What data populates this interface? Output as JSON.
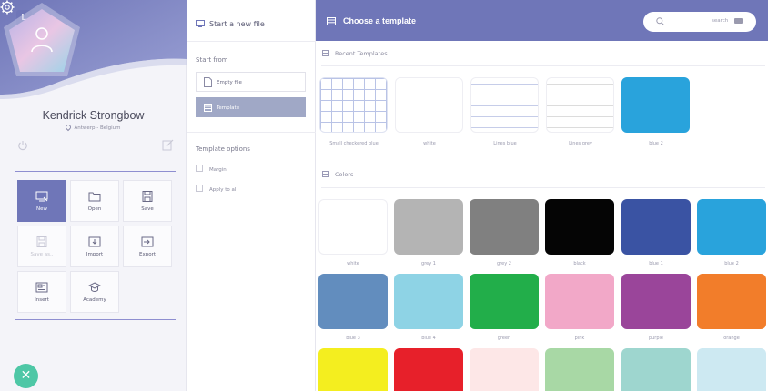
{
  "left": {
    "logo_letter": "L",
    "user": {
      "name": "Kendrick Strongbow",
      "location": "Antwerp - Belgium"
    },
    "actions": [
      {
        "label": "New",
        "icon": "new-file-icon",
        "state": "active"
      },
      {
        "label": "Open",
        "icon": "folder-icon",
        "state": "normal"
      },
      {
        "label": "Save",
        "icon": "floppy-icon",
        "state": "normal"
      },
      {
        "label": "Save as..",
        "icon": "floppy-as-icon",
        "state": "disabled"
      },
      {
        "label": "Import",
        "icon": "import-icon",
        "state": "normal"
      },
      {
        "label": "Export",
        "icon": "export-icon",
        "state": "normal"
      },
      {
        "label": "Insert",
        "icon": "insert-icon",
        "state": "normal"
      },
      {
        "label": "Academy",
        "icon": "graduation-cap-icon",
        "state": "normal"
      }
    ],
    "fab_symbol": "✕"
  },
  "middle": {
    "heading": "Start a new file",
    "start_from_label": "Start from",
    "options": [
      {
        "label": "Empty file",
        "selected": false
      },
      {
        "label": "Template",
        "selected": true
      }
    ],
    "template_options_label": "Template options",
    "checkboxes": [
      {
        "label": "Margin",
        "checked": false
      },
      {
        "label": "Apply to all",
        "checked": false
      }
    ]
  },
  "right": {
    "title": "Choose a template",
    "search_placeholder": "search",
    "recent_label": "Recent Templates",
    "recent": [
      {
        "label": "Small checkered blue",
        "style": "grid"
      },
      {
        "label": "white",
        "style": "blank"
      },
      {
        "label": "Lines blue",
        "style": "lines-blue"
      },
      {
        "label": "Lines grey",
        "style": "lines-grey"
      },
      {
        "label": "blue 2",
        "style": "fill",
        "color": "#29a3dc"
      }
    ],
    "colors_label": "Colors",
    "colors": [
      {
        "label": "white",
        "color": "#ffffff"
      },
      {
        "label": "grey 1",
        "color": "#b4b4b4"
      },
      {
        "label": "grey 2",
        "color": "#808080"
      },
      {
        "label": "black",
        "color": "#050505"
      },
      {
        "label": "blue 1",
        "color": "#3a53a3"
      },
      {
        "label": "blue 2",
        "color": "#29a3dc"
      },
      {
        "label": "blue 3",
        "color": "#628dbe"
      },
      {
        "label": "blue 4",
        "color": "#8ed3e5"
      },
      {
        "label": "green",
        "color": "#22ae4a"
      },
      {
        "label": "pink",
        "color": "#f2a8c8"
      },
      {
        "label": "purple",
        "color": "#9a459a"
      },
      {
        "label": "orange",
        "color": "#f27d2a"
      },
      {
        "label": "",
        "color": "#f4ee1f"
      },
      {
        "label": "",
        "color": "#e7202a"
      },
      {
        "label": "",
        "color": "#fde7e7"
      },
      {
        "label": "",
        "color": "#a8d8a5"
      },
      {
        "label": "",
        "color": "#9ed6cf"
      },
      {
        "label": "",
        "color": "#cde9f2"
      }
    ]
  },
  "colors": {
    "accent": "#6f76b8",
    "fab": "#4ec7a6",
    "selected_option": "#a0a8c6"
  }
}
